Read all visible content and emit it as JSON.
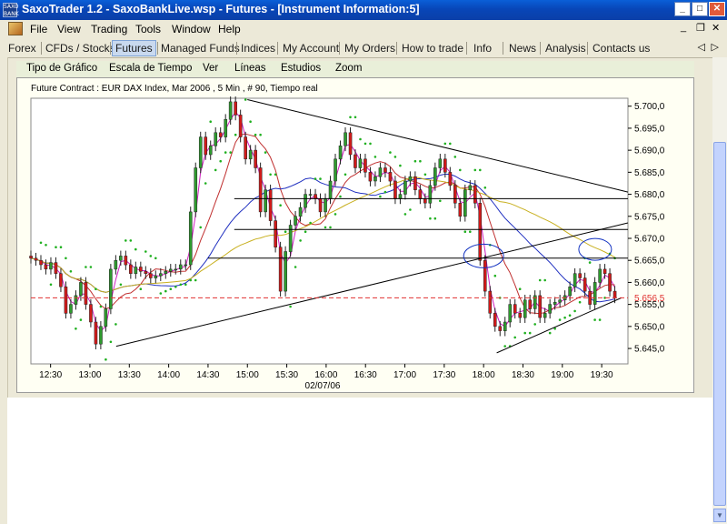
{
  "window": {
    "title": "SaxoTrader 1.2 - SaxoBankLive.wsp - Futures - [Instrument Information:5]",
    "app_icon_text": "SAXO BANK",
    "btn_min": "_",
    "btn_max": "□",
    "btn_close": "✕"
  },
  "menu": {
    "items": [
      "File",
      "View",
      "Trading",
      "Tools",
      "Window",
      "Help"
    ],
    "mdi_min": "_",
    "mdi_restore": "❐",
    "mdi_close": "✕"
  },
  "nav": {
    "tabs": [
      "Forex",
      "CFDs / Stocks",
      "Futures",
      "Managed Funds",
      "Indices",
      "My Account",
      "My Orders",
      "How to trade",
      "Info",
      "News",
      "Analysis",
      "Contacts us"
    ],
    "selected": "Futures",
    "arrow_left": "◁",
    "arrow_right": "▷"
  },
  "chart_toolbar": {
    "items": [
      "Tipo de Gráfico",
      "Escala de Tiempo",
      "Ver",
      "Líneas",
      "Estudios",
      "Zoom"
    ]
  },
  "chart_data": {
    "type": "candlestick",
    "title": "Future Contract : EUR DAX Index, Mar 2006 , 5 Min , # 90, Tiempo real",
    "date_label": "02/07/06",
    "x_ticks": [
      "12:30",
      "13:00",
      "13:30",
      "14:00",
      "14:30",
      "15:00",
      "15:30",
      "16:00",
      "16:30",
      "17:00",
      "17:30",
      "18:00",
      "18:30",
      "19:00",
      "19:30"
    ],
    "y_ticks": [
      "5.700,0",
      "5.695,0",
      "5.690,0",
      "5.685,0",
      "5.680,0",
      "5.675,0",
      "5.670,0",
      "5.665,0",
      "5.660,0",
      "5.655,0",
      "5.650,0",
      "5.645,0"
    ],
    "y_tick_values": [
      5700,
      5695,
      5690,
      5685,
      5680,
      5675,
      5670,
      5665,
      5660,
      5655,
      5650,
      5645
    ],
    "ylim": [
      5641.5,
      5701.8
    ],
    "xlim": [
      "12:15",
      "19:50"
    ],
    "last_price_label": "5.656,5",
    "last_price": 5656.5,
    "colors": {
      "up": "#2e9a2e",
      "down": "#d21a1a",
      "ma_fast": "#d020c0",
      "ma_mid": "#c03030",
      "ma_slow": "#2030c0",
      "ma_long": "#c8b020",
      "sar": "#20b020",
      "last_price": "#e03030",
      "ellipse": "#1030c0"
    },
    "closes": [
      5665.5,
      5665.0,
      5664.0,
      5663.0,
      5664.5,
      5662.0,
      5659.0,
      5653.0,
      5655.0,
      5657.0,
      5660.0,
      5655.0,
      5651.0,
      5646.0,
      5650.0,
      5654.0,
      5663.0,
      5665.0,
      5666.0,
      5664.0,
      5662.0,
      5663.5,
      5662.5,
      5662.0,
      5661.0,
      5661.5,
      5662.0,
      5662.5,
      5663.0,
      5663.0,
      5664.0,
      5664.0,
      5676.0,
      5686.0,
      5693.0,
      5689.0,
      5691.0,
      5694.0,
      5693.0,
      5697.0,
      5701.0,
      5698.0,
      5693.0,
      5688.0,
      5690.0,
      5686.0,
      5676.0,
      5681.0,
      5674.0,
      5668.0,
      5658.0,
      5667.0,
      5673.0,
      5675.0,
      5677.0,
      5680.0,
      5680.0,
      5679.0,
      5676.0,
      5679.0,
      5683.0,
      5688.0,
      5691.0,
      5694.0,
      5689.0,
      5686.0,
      5688.0,
      5685.0,
      5683.0,
      5684.0,
      5686.0,
      5685.0,
      5683.0,
      5679.0,
      5680.0,
      5683.0,
      5684.0,
      5681.0,
      5679.0,
      5678.0,
      5682.0,
      5686.0,
      5688.0,
      5685.0,
      5682.0,
      5678.0,
      5675.0,
      5681.0,
      5682.0,
      5678.0,
      5665.0,
      5658.0,
      5653.0,
      5650.0,
      5649.0,
      5651.0,
      5655.0,
      5653.0,
      5652.0,
      5656.0,
      5654.0,
      5657.0,
      5652.0,
      5653.0,
      5655.0,
      5655.5,
      5656.0,
      5657.0,
      5659.0,
      5662.0,
      5661.0,
      5658.0,
      5655.0,
      5660.0,
      5663.0,
      5662.0,
      5658.0,
      5656.5
    ]
  }
}
